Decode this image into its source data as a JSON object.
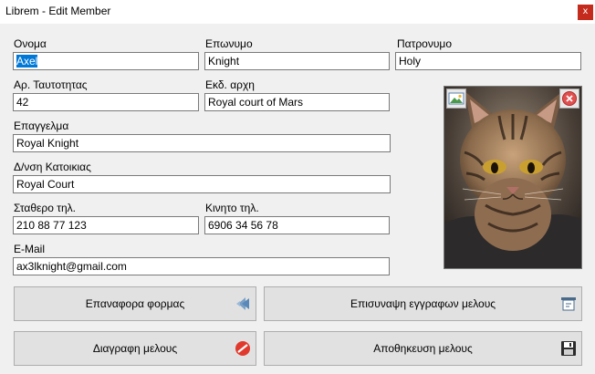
{
  "window": {
    "title": "Librem - Edit Member",
    "close_glyph": "x"
  },
  "form": {
    "first_name": {
      "label": "Ονομα",
      "value": "Axel"
    },
    "last_name": {
      "label": "Επωνυμο",
      "value": "Knight"
    },
    "fathers_name": {
      "label": "Πατρονυμο",
      "value": "Holy"
    },
    "id_number": {
      "label": "Αρ. Ταυτοτητας",
      "value": "42"
    },
    "issuing_authority": {
      "label": "Εκδ. αρχη",
      "value": "Royal court of Mars"
    },
    "occupation": {
      "label": "Επαγγελμα",
      "value": "Royal Knight"
    },
    "address": {
      "label": "Δ/νση Κατοικιας",
      "value": "Royal Court"
    },
    "landline": {
      "label": "Σταθερο τηλ.",
      "value": "210 88 77 123"
    },
    "mobile": {
      "label": "Κινητο τηλ.",
      "value": "6906 34 56 78"
    },
    "email": {
      "label": "E-Mail",
      "value": "ax3lknight@gmail.com"
    }
  },
  "photo": {
    "add_icon": "image-icon",
    "remove_icon": "remove-circle-icon"
  },
  "buttons": {
    "reset": {
      "label": "Επαναφορα φορμας",
      "icon": "reset-icon"
    },
    "attach": {
      "label": "Επισυναψη εγγραφων μελους",
      "icon": "attach-document-icon"
    },
    "delete": {
      "label": "Διαγραφη μελους",
      "icon": "delete-icon"
    },
    "save": {
      "label": "Αποθηκευση μελους",
      "icon": "save-icon"
    }
  },
  "colors": {
    "selection": "#0078d7",
    "close": "#c42b1c",
    "delete_icon": "#e03a2e"
  }
}
